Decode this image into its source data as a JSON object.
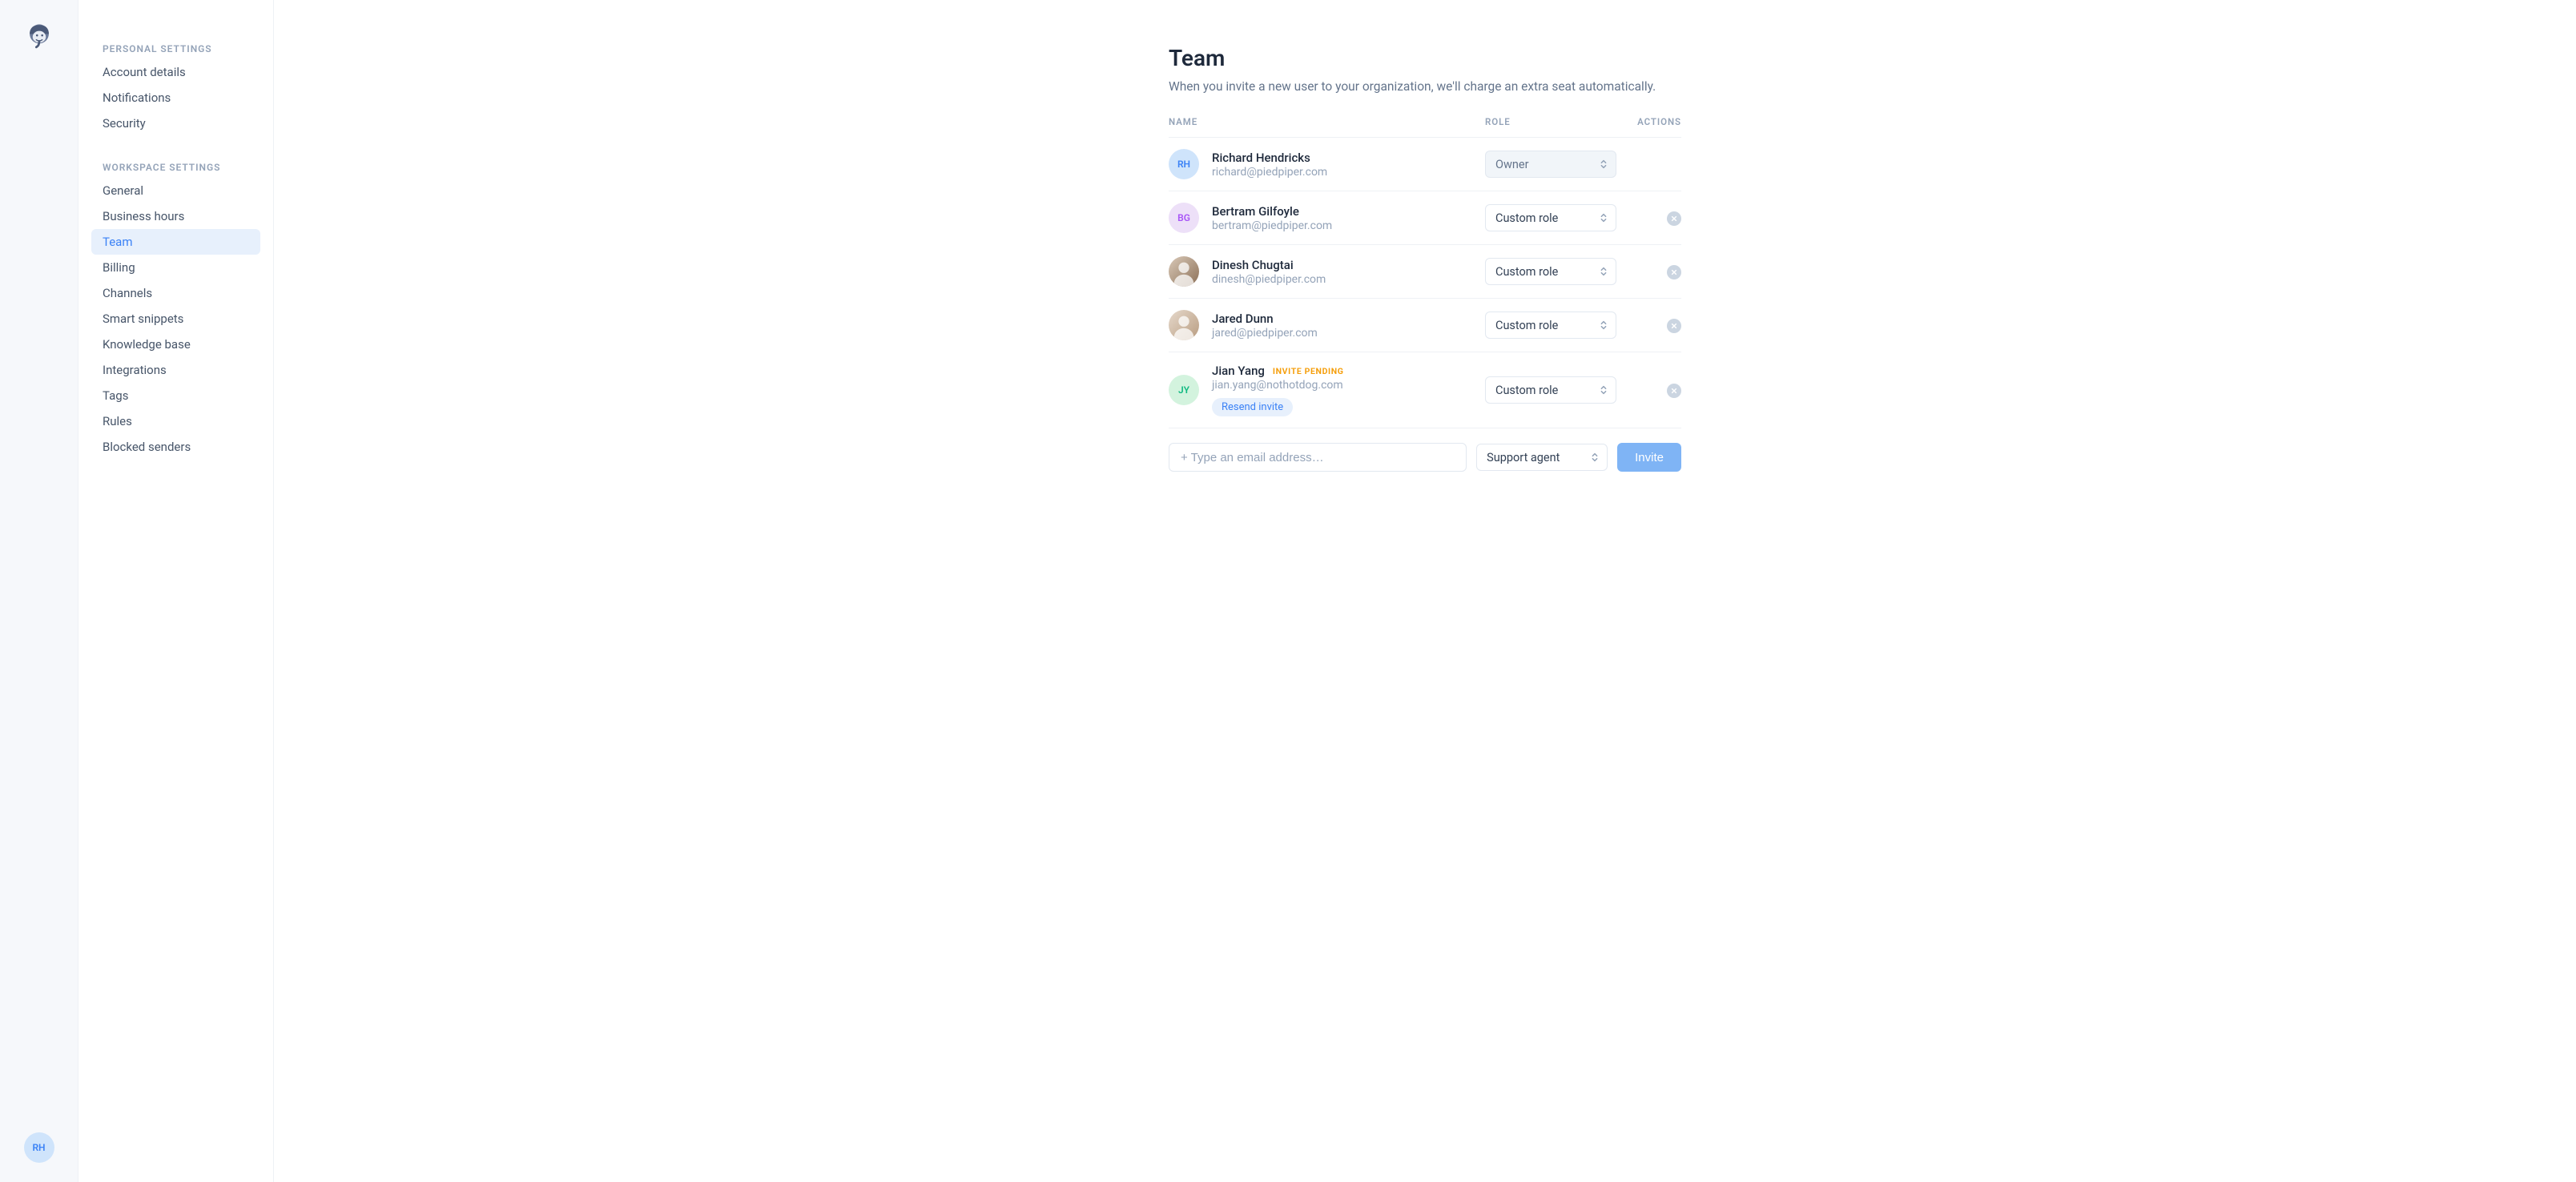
{
  "rail": {
    "me_initials": "RH"
  },
  "sidebar": {
    "personal_heading": "PERSONAL SETTINGS",
    "workspace_heading": "WORKSPACE SETTINGS",
    "personal": [
      {
        "label": "Account details"
      },
      {
        "label": "Notifications"
      },
      {
        "label": "Security"
      }
    ],
    "workspace": [
      {
        "label": "General"
      },
      {
        "label": "Business hours"
      },
      {
        "label": "Team",
        "active": true
      },
      {
        "label": "Billing"
      },
      {
        "label": "Channels"
      },
      {
        "label": "Smart snippets"
      },
      {
        "label": "Knowledge base"
      },
      {
        "label": "Integrations"
      },
      {
        "label": "Tags"
      },
      {
        "label": "Rules"
      },
      {
        "label": "Blocked senders"
      }
    ]
  },
  "page": {
    "title": "Team",
    "subtitle": "When you invite a new user to your organization, we'll charge an extra seat automatically."
  },
  "columns": {
    "name": "NAME",
    "role": "ROLE",
    "actions": "ACTIONS"
  },
  "members": [
    {
      "initials": "RH",
      "avatar_bg": "#cfe4fb",
      "avatar_fg": "#3b82f6",
      "name": "Richard Hendricks",
      "email": "richard@piedpiper.com",
      "role": "Owner",
      "role_locked": true,
      "removable": false
    },
    {
      "initials": "BG",
      "avatar_bg": "#ede0f8",
      "avatar_fg": "#a855f7",
      "name": "Bertram Gilfoyle",
      "email": "bertram@piedpiper.com",
      "role": "Custom role",
      "role_locked": false,
      "removable": true
    },
    {
      "photo": true,
      "avatar_class": "img1",
      "name": "Dinesh Chugtai",
      "email": "dinesh@piedpiper.com",
      "role": "Custom role",
      "role_locked": false,
      "removable": true
    },
    {
      "photo": true,
      "avatar_class": "img2",
      "name": "Jared Dunn",
      "email": "jared@piedpiper.com",
      "role": "Custom role",
      "role_locked": false,
      "removable": true
    },
    {
      "initials": "JY",
      "avatar_bg": "#d3f3de",
      "avatar_fg": "#10b981",
      "name": "Jian Yang",
      "email": "jian.yang@nothotdog.com",
      "role": "Custom role",
      "role_locked": false,
      "removable": true,
      "pending": true,
      "pending_label": "INVITE PENDING",
      "resend_label": "Resend invite"
    }
  ],
  "invite": {
    "placeholder": "+ Type an email address…",
    "role": "Support agent",
    "button": "Invite"
  }
}
